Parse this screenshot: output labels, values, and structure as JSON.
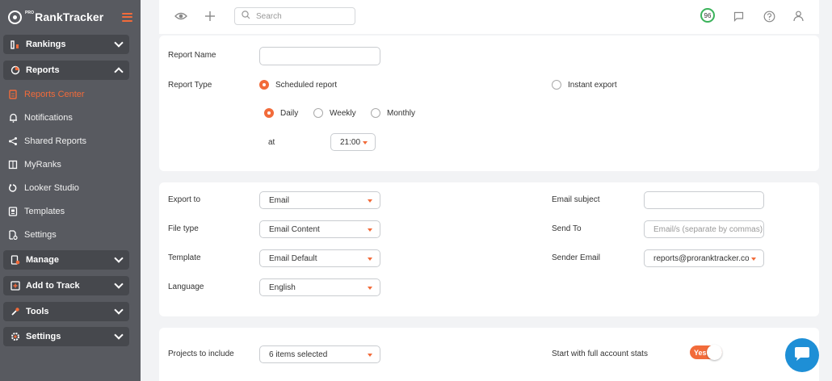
{
  "brand": {
    "name": "RankTracker",
    "prefix": "PRO",
    "accent": "#f26b3a"
  },
  "sidebar": {
    "groups": [
      {
        "label": "Rankings",
        "icon": "rankings-icon"
      },
      {
        "label": "Reports",
        "icon": "reports-icon",
        "expanded": true
      },
      {
        "label": "Manage",
        "icon": "manage-icon"
      },
      {
        "label": "Add to Track",
        "icon": "add-to-track-icon"
      },
      {
        "label": "Tools",
        "icon": "tools-icon"
      },
      {
        "label": "Settings",
        "icon": "settings-group-icon"
      }
    ],
    "report_items": [
      {
        "label": "Reports Center",
        "active": true
      },
      {
        "label": "Notifications"
      },
      {
        "label": "Shared Reports"
      },
      {
        "label": "MyRanks"
      },
      {
        "label": "Looker Studio"
      },
      {
        "label": "Templates"
      },
      {
        "label": "Settings"
      }
    ]
  },
  "topbar": {
    "search_placeholder": "Search",
    "score": "96"
  },
  "report": {
    "name_label": "Report Name",
    "name_value": "",
    "type_label": "Report Type",
    "scheduled_label": "Scheduled report",
    "instant_label": "Instant export",
    "freq": {
      "daily": "Daily",
      "weekly": "Weekly",
      "monthly": "Monthly"
    },
    "at_label": "at",
    "time_value": "21:00"
  },
  "export": {
    "export_to_label": "Export to",
    "export_to_value": "Email",
    "file_type_label": "File type",
    "file_type_value": "Email Content",
    "template_label": "Template",
    "template_value": "Email Default",
    "language_label": "Language",
    "language_value": "English",
    "subject_label": "Email subject",
    "subject_value": "",
    "send_to_label": "Send To",
    "send_to_placeholder": "Email/s (separate by commas)",
    "sender_label": "Sender Email",
    "sender_value": "reports@proranktracker.com"
  },
  "projects": {
    "label": "Projects to include",
    "value": "6 items selected",
    "full_stats_label": "Start with full account stats",
    "toggle_label": "Yes"
  }
}
